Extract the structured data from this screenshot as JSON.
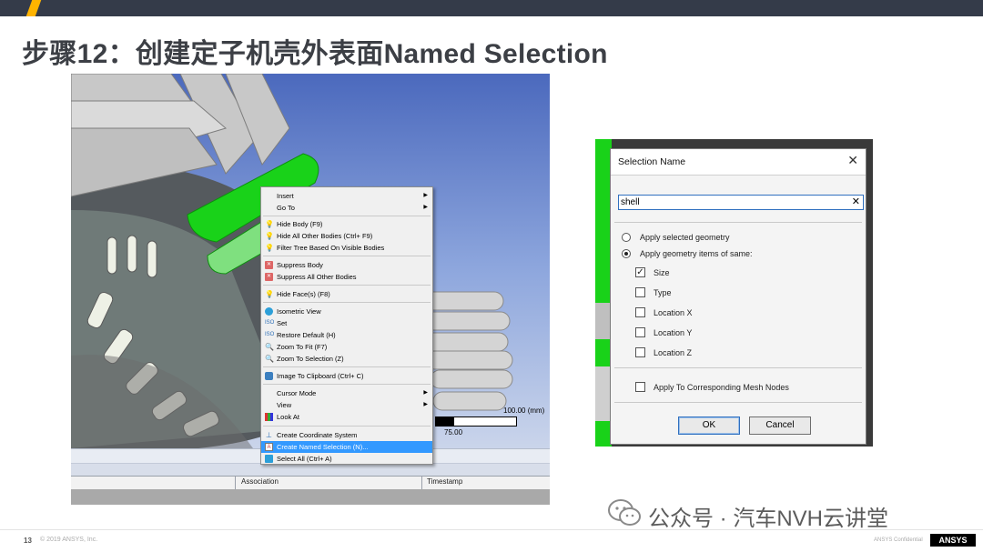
{
  "slide": {
    "title": "步骤12：创建定子机壳外表面Named Selection",
    "page_number": "13",
    "copyright": "© 2019 ANSYS, Inc.",
    "confidential": "ANSYS Confidential",
    "logo_text": "ANSYS",
    "watermark": "公众号 · 汽车NVH云讲堂"
  },
  "viewport": {
    "scale_top": "100.00 (mm)",
    "scale_mid": "75.00",
    "table_cols": [
      "Association",
      "Timestamp"
    ]
  },
  "context_menu": {
    "items": [
      {
        "label": "Insert",
        "icon": "",
        "submenu": true
      },
      {
        "label": "Go To",
        "icon": "",
        "submenu": true
      },
      {
        "label": "Hide Body (F9)",
        "icon": "lightbulb-icon"
      },
      {
        "label": "Hide All Other Bodies (Ctrl+ F9)",
        "icon": "lightbulb-icon"
      },
      {
        "label": "Filter Tree Based On Visible Bodies",
        "icon": "lightbulb-yellow-icon"
      },
      {
        "label": "Suppress Body",
        "icon": "suppress-icon"
      },
      {
        "label": "Suppress All Other Bodies",
        "icon": "suppress-icon"
      },
      {
        "label": "Hide Face(s) (F8)",
        "icon": "lightbulb-icon"
      },
      {
        "label": "Isometric View",
        "icon": "isometric-icon"
      },
      {
        "label": "Set",
        "icon": "iso-set-icon"
      },
      {
        "label": "Restore Default (H)",
        "icon": "iso-restore-icon"
      },
      {
        "label": "Zoom To Fit (F7)",
        "icon": "zoom-fit-icon"
      },
      {
        "label": "Zoom To Selection (Z)",
        "icon": "zoom-selection-icon"
      },
      {
        "label": "Image To Clipboard (Ctrl+ C)",
        "icon": "camera-icon"
      },
      {
        "label": "Cursor Mode",
        "icon": "",
        "submenu": true
      },
      {
        "label": "View",
        "icon": "",
        "submenu": true
      },
      {
        "label": "Look At",
        "icon": "look-at-icon"
      },
      {
        "label": "Create Coordinate System",
        "icon": "coordinate-system-icon"
      },
      {
        "label": "Create Named Selection (N)...",
        "icon": "named-selection-icon",
        "highlighted": true
      },
      {
        "label": "Select All (Ctrl+ A)",
        "icon": "select-all-icon"
      }
    ]
  },
  "dialog": {
    "title": "Selection Name",
    "input_value": "shell",
    "radio_apply_selected": "Apply selected geometry",
    "radio_apply_items": "Apply geometry items of same:",
    "selected_radio": "Apply geometry items of same:",
    "checkboxes": [
      {
        "label": "Size",
        "checked": true
      },
      {
        "label": "Type",
        "checked": false
      },
      {
        "label": "Location X",
        "checked": false
      },
      {
        "label": "Location Y",
        "checked": false
      },
      {
        "label": "Location Z",
        "checked": false
      }
    ],
    "mesh_nodes_label": "Apply To Corresponding Mesh Nodes",
    "mesh_nodes_checked": false,
    "ok_label": "OK",
    "cancel_label": "Cancel"
  },
  "colors": {
    "topbar": "#343b49",
    "accent": "#ffb400",
    "selected_face": "#19d219",
    "menu_highlight": "#3399ff"
  }
}
